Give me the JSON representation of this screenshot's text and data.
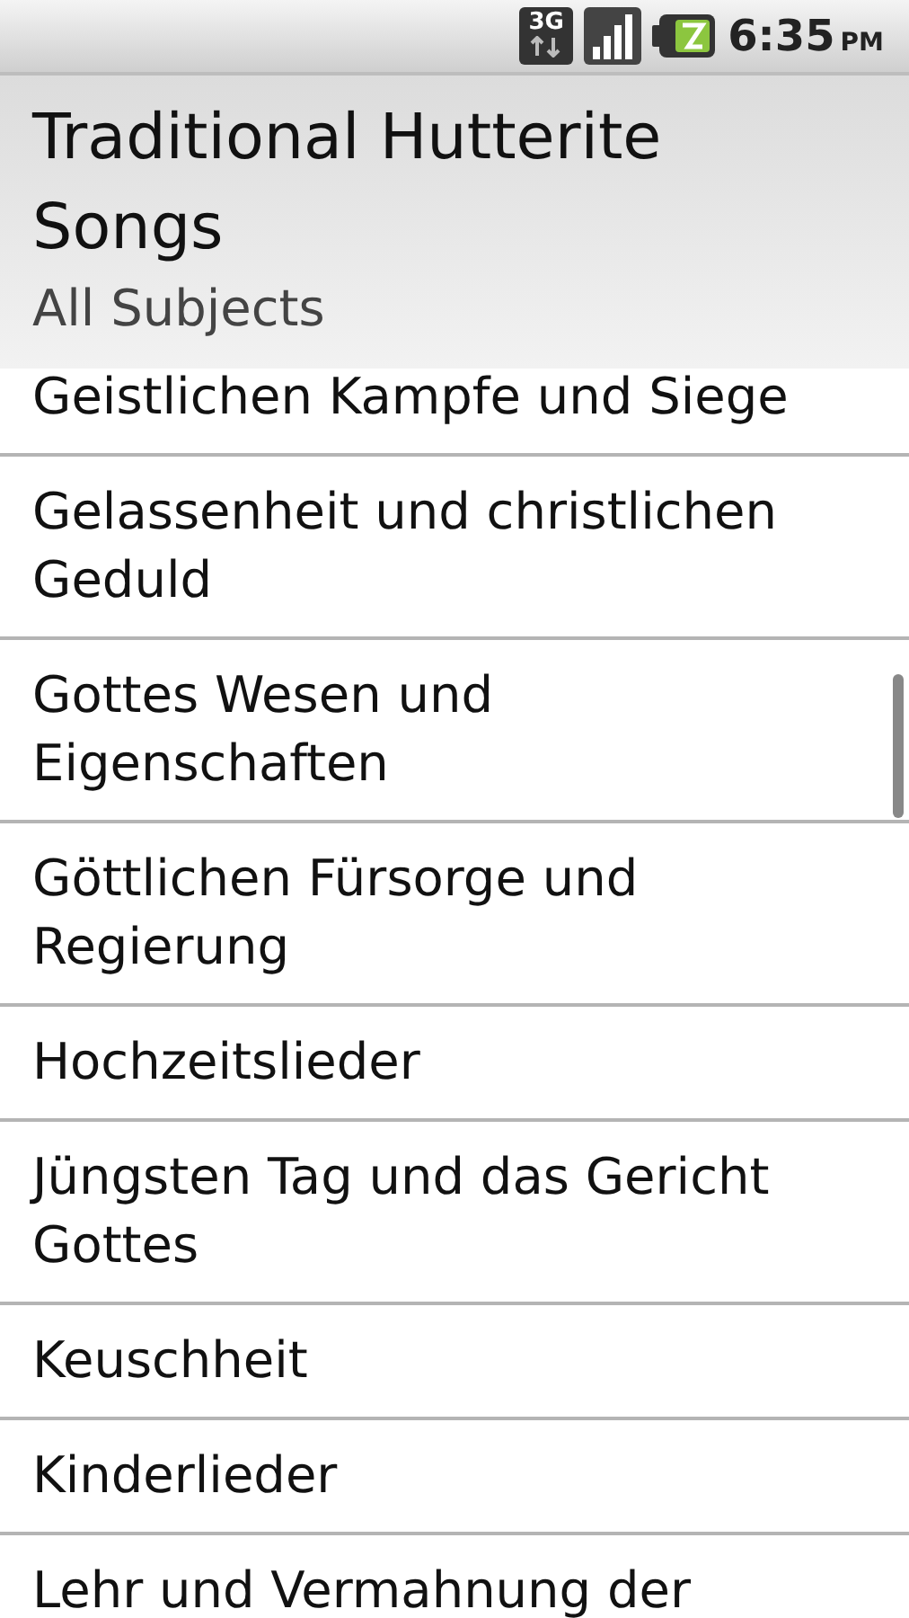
{
  "status_bar": {
    "network": "3G",
    "time": "6:35",
    "meridiem": "PM"
  },
  "header": {
    "title": "Traditional Hutterite Songs",
    "subtitle": "All Subjects"
  },
  "list": {
    "items": [
      {
        "label": "Geistlichen Kampfe und Siege"
      },
      {
        "label": "Gelassenheit und christlichen Geduld"
      },
      {
        "label": "Gottes Wesen und Eigenschaften"
      },
      {
        "label": "Göttlichen Fürsorge und Regierung"
      },
      {
        "label": "Hochzeitslieder"
      },
      {
        "label": "Jüngsten Tag und das Gericht Gottes"
      },
      {
        "label": "Keuschheit"
      },
      {
        "label": "Kinderlieder"
      },
      {
        "label": "Lehr und Vermahnung der"
      }
    ]
  }
}
